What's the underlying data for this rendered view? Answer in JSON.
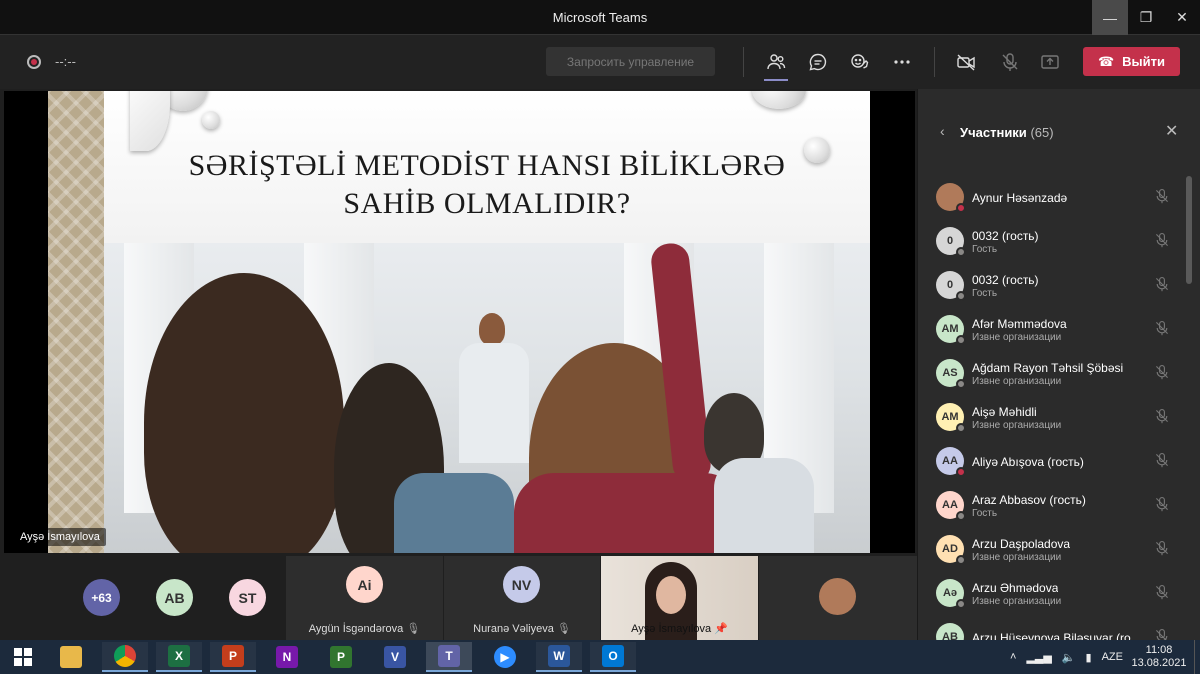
{
  "window": {
    "title": "Microsoft Teams"
  },
  "toolbar": {
    "timer": "--:--",
    "request_control_label": "Запросить управление",
    "leave_label": "Выйти"
  },
  "slide": {
    "title_line1": "SƏRİŞTƏLİ METODİST HANSI BİLİKLƏRƏ",
    "title_line2": "SAHİB OLMALIDIR?",
    "presenter_name": "Ayşə İsmayılova"
  },
  "tiles": {
    "more_count": "+63",
    "ab_initials": "AB",
    "st_initials": "ST",
    "aygun_initials": "Ai",
    "aygun_name": "Aygün İsgəndərova",
    "nurana_initials": "NV",
    "nurana_name": "Nuranə Vəliyeva",
    "ayse_name": "Ayşə İsmayılova"
  },
  "panel": {
    "title": "Участники",
    "count": "(65)",
    "participants": [
      {
        "initials": "",
        "name": "Aynur Həsənzadə",
        "sub": "",
        "color": "#b07a5a",
        "status": "red"
      },
      {
        "initials": "0",
        "name": "0032 (гость)",
        "sub": "Гость",
        "color": "#d6d6d6",
        "status": "gray"
      },
      {
        "initials": "0",
        "name": "0032 (гость)",
        "sub": "Гость",
        "color": "#d6d6d6",
        "status": "gray"
      },
      {
        "initials": "AM",
        "name": "Afər Məmmədova",
        "sub": "Извне организации",
        "color": "#c8e6c9",
        "status": "gray"
      },
      {
        "initials": "AS",
        "name": "Ağdam Rayon Təhsil Şöbəsi",
        "sub": "Извне организации",
        "color": "#c8e6c9",
        "status": "gray"
      },
      {
        "initials": "AM",
        "name": "Aişə Məhidli",
        "sub": "Извне организации",
        "color": "#fff0b3",
        "status": "gray"
      },
      {
        "initials": "AA",
        "name": "Aliyə Abışova (гость)",
        "sub": "",
        "color": "#c5cae9",
        "status": "red"
      },
      {
        "initials": "AA",
        "name": "Araz Abbasov (гость)",
        "sub": "Гость",
        "color": "#ffd6cc",
        "status": "gray"
      },
      {
        "initials": "AD",
        "name": "Arzu Daşpoladova",
        "sub": "Извне организации",
        "color": "#ffe0b2",
        "status": "gray"
      },
      {
        "initials": "Aə",
        "name": "Arzu Əhmədova",
        "sub": "Извне организации",
        "color": "#c8e6c9",
        "status": "gray"
      },
      {
        "initials": "AB",
        "name": "Arzu Hüseynova Biləsuvar (ro...",
        "sub": "",
        "color": "#c8e6c9",
        "status": "gray"
      }
    ]
  },
  "taskbar": {
    "lang": "AZE",
    "time": "11:08",
    "date": "13.08.2021"
  },
  "colors": {
    "accent": "#8b8cc7",
    "leave": "#c4314b",
    "background": "#1f1f1f"
  }
}
